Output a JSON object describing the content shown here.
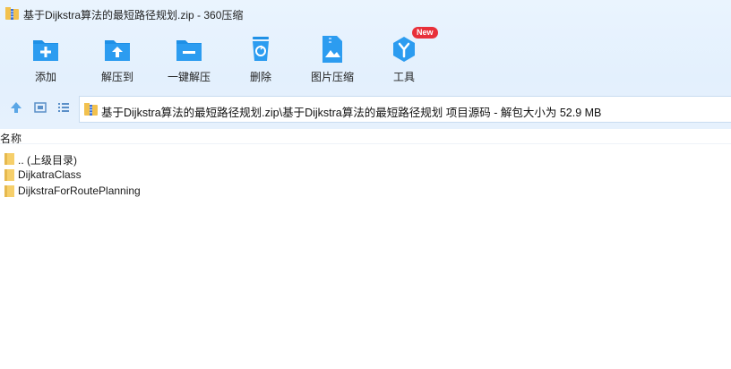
{
  "window": {
    "title": "基于Dijkstra算法的最短路径规划.zip - 360压缩"
  },
  "toolbar": {
    "items": [
      {
        "label": "添加",
        "icon": "add-icon"
      },
      {
        "label": "解压到",
        "icon": "extract-to-icon"
      },
      {
        "label": "一键解压",
        "icon": "one-click-extract-icon"
      },
      {
        "label": "删除",
        "icon": "delete-icon"
      },
      {
        "label": "图片压缩",
        "icon": "image-compress-icon"
      },
      {
        "label": "工具",
        "icon": "tools-icon",
        "badge": "New"
      }
    ]
  },
  "nav": {
    "path": "基于Dijkstra算法的最短路径规划.zip\\基于Dijkstra算法的最短路径规划 项目源码 - 解包大小为 52.9 MB"
  },
  "file_list": {
    "column_name": "名称",
    "rows": [
      {
        "name": ".. (上级目录)"
      },
      {
        "name": "DijkatraClass"
      },
      {
        "name": "DijkstraForRoutePlanning"
      }
    ]
  },
  "colors": {
    "accent": "#1e90e6",
    "folder": "#f6cf6a",
    "badge": "#e8303a"
  }
}
